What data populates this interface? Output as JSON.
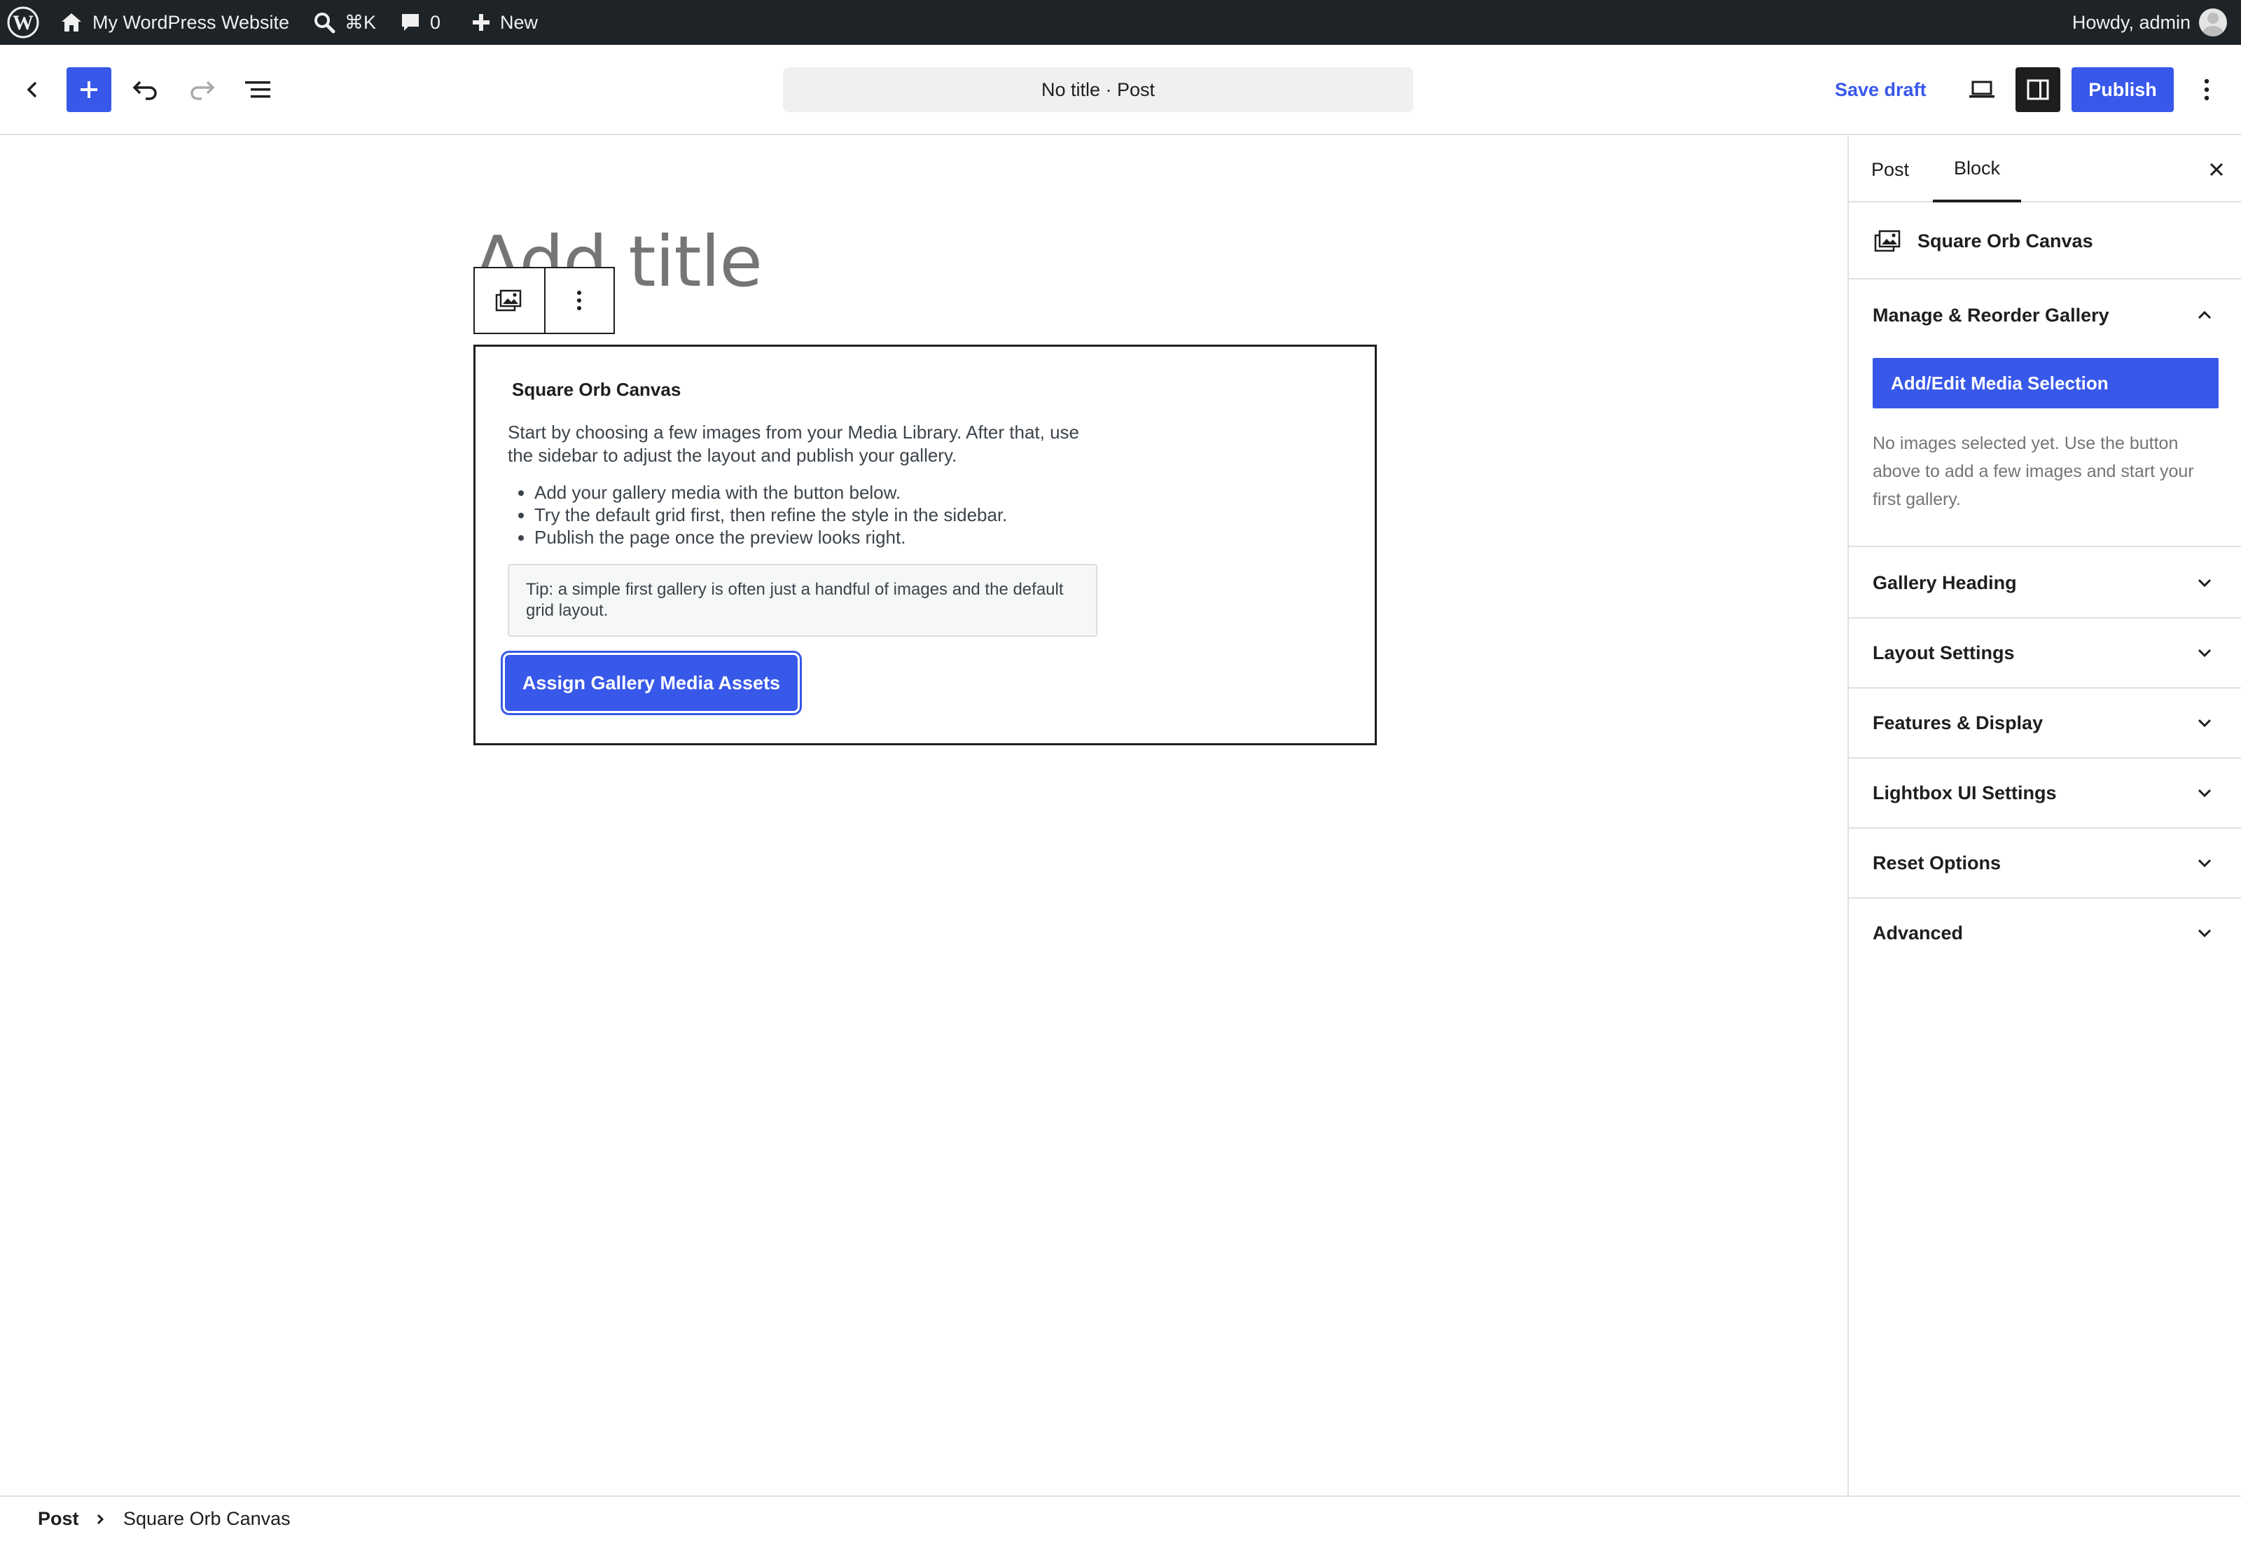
{
  "admin_bar": {
    "site_name": "My WordPress Website",
    "search_shortcut": "⌘K",
    "comments_count": "0",
    "new_label": "New",
    "greeting": "Howdy, admin"
  },
  "editor_header": {
    "document_title": "No title · Post",
    "save_draft_label": "Save draft",
    "publish_label": "Publish"
  },
  "canvas": {
    "title_placeholder": "Add title",
    "block": {
      "title": "Square Orb Canvas",
      "description": "Start by choosing a few images from your Media Library. After that, use the sidebar to adjust the layout and publish your gallery.",
      "steps": [
        "Add your gallery media with the button below.",
        "Try the default grid first, then refine the style in the sidebar.",
        "Publish the page once the preview looks right."
      ],
      "tip": "Tip: a simple first gallery is often just a handful of images and the default grid layout.",
      "button_label": "Assign Gallery Media Assets"
    }
  },
  "sidebar": {
    "tabs": [
      "Post",
      "Block"
    ],
    "active_tab": "Block",
    "block_name": "Square Orb Canvas",
    "panels": [
      {
        "title": "Manage & Reorder Gallery",
        "expanded": true,
        "button_label": "Add/Edit Media Selection",
        "help": "No images selected yet. Use the button above to add a few images and start your first gallery."
      },
      {
        "title": "Gallery Heading",
        "expanded": false
      },
      {
        "title": "Layout Settings",
        "expanded": false
      },
      {
        "title": "Features & Display",
        "expanded": false
      },
      {
        "title": "Lightbox UI Settings",
        "expanded": false
      },
      {
        "title": "Reset Options",
        "expanded": false
      },
      {
        "title": "Advanced",
        "expanded": false
      }
    ]
  },
  "footer": {
    "breadcrumb": [
      "Post",
      "Square Orb Canvas"
    ]
  },
  "colors": {
    "accent": "#3858e9",
    "admin_bar": "#1d2327",
    "text": "#1e1e1e"
  }
}
